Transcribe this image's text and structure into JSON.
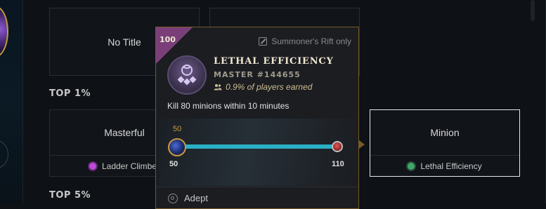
{
  "cards_top": [
    {
      "title": "No Title"
    },
    {
      "title": ""
    }
  ],
  "sections": {
    "top1": "TOP 1%",
    "top5": "TOP 5%"
  },
  "cards_mid": {
    "left": {
      "title": "Masterful",
      "challenge": "Ladder Climber",
      "gem_color": "#c04ad8"
    },
    "right": {
      "title": "Minion",
      "challenge": "Lethal Efficiency",
      "gem_color": "#3ea86a"
    }
  },
  "tooltip": {
    "level_badge": "100",
    "mode_text": "Summoner's Rift only",
    "title": "LETHAL EFFICIENCY",
    "rank": "MASTER #144655",
    "earned": "0.9% of players earned",
    "description": "Kill 80 minions within 10 minutes",
    "progress": {
      "current_label": "50",
      "min_label": "50",
      "max_label": "110",
      "current": 50,
      "min": 50,
      "max": 110
    },
    "next_tier": "Adept",
    "accent": "#785a28",
    "badge_color": "#7a3f78"
  }
}
